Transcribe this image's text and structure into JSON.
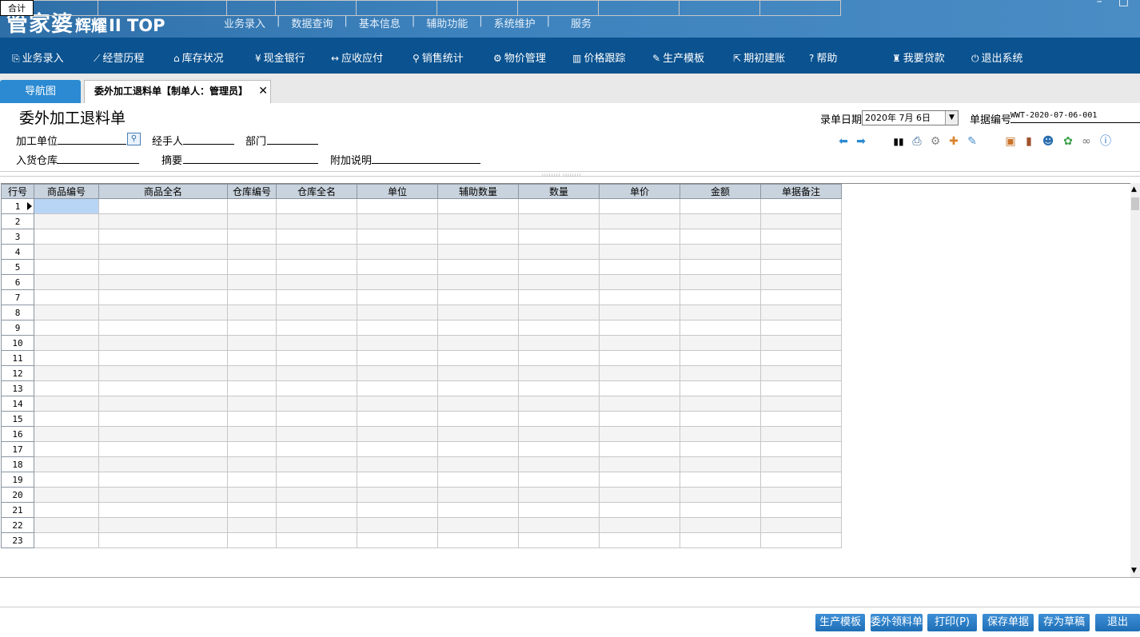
{
  "logo": {
    "brand": "管家婆",
    "edition": "辉耀",
    "version": "II TOP"
  },
  "topmenu": [
    "业务录入",
    "数据查询",
    "基本信息",
    "辅助功能",
    "系统维护",
    "服务"
  ],
  "window_controls": [
    "–",
    "□"
  ],
  "nav": [
    {
      "icon": "⎘",
      "label": "业务录入"
    },
    {
      "icon": "⟋",
      "label": "经营历程"
    },
    {
      "icon": "⌂",
      "label": "库存状况"
    },
    {
      "icon": "¥",
      "label": "现金银行"
    },
    {
      "icon": "↔",
      "label": "应收应付"
    },
    {
      "icon": "⚲",
      "label": "销售统计"
    },
    {
      "icon": "⚙",
      "label": "物价管理"
    },
    {
      "icon": "▥",
      "label": "价格跟踪"
    },
    {
      "icon": "✎",
      "label": "生产模板"
    },
    {
      "icon": "⇱",
      "label": "期初建账"
    },
    {
      "icon": "?",
      "label": "帮助"
    },
    {
      "icon": "♜",
      "label": "我要贷款"
    },
    {
      "icon": "⏻",
      "label": "退出系统"
    }
  ],
  "tabs": {
    "nav_tab": "导航图",
    "doc_tab": "委外加工退料单【制单人：管理员】",
    "close": "✕"
  },
  "form": {
    "title": "委外加工退料单",
    "processing_unit_label": "加工单位",
    "handler_label": "经手人",
    "department_label": "部门",
    "warehouse_label": "入货仓库",
    "summary_label": "摘要",
    "note_label": "附加说明",
    "date_label": "录单日期",
    "date_value": "2020年 7月 6日",
    "bill_no_label": "单据编号",
    "bill_no_value": "WWT-2020-07-06-001"
  },
  "toolbar_icons": [
    "arrow-left-icon",
    "arrow-right-icon",
    "barcode-icon",
    "printer-icon",
    "gear-icon",
    "add-item-icon",
    "edit-icon",
    "box-icon",
    "door-icon",
    "user-icon",
    "leaf-icon",
    "link-icon",
    "help-icon"
  ],
  "grid": {
    "headers": [
      "行号",
      "商品编号",
      "商品全名",
      "仓库编号",
      "仓库全名",
      "单位",
      "辅助数量",
      "数量",
      "单价",
      "金额",
      "单据备注"
    ],
    "rows": [
      "1",
      "2",
      "3",
      "4",
      "5",
      "6",
      "7",
      "8",
      "9",
      "10",
      "11",
      "12",
      "13",
      "14",
      "15",
      "16",
      "17",
      "18",
      "19",
      "20",
      "21",
      "22",
      "23"
    ],
    "total_label": "合计"
  },
  "buttons": [
    "生产模板",
    "委外领料单",
    "打印(P)",
    "保存单据",
    "存为草稿",
    "退出"
  ],
  "colors": {
    "topbar": "#3d82bd",
    "navbar": "#0a5290",
    "accent": "#2b8ad2"
  }
}
